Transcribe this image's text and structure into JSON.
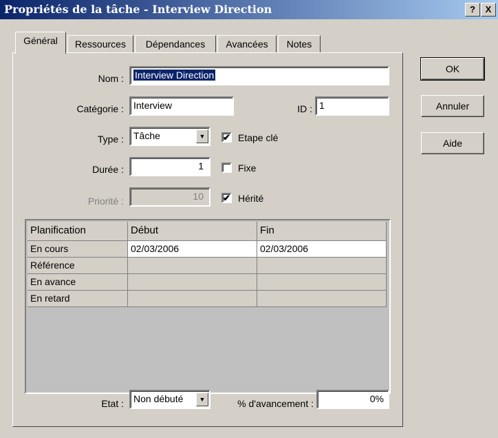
{
  "window": {
    "title": "Propriétés de la tâche - Interview Direction",
    "help_btn": "?",
    "close_btn": "X"
  },
  "tabs": [
    "Général",
    "Ressources",
    "Dépendances",
    "Avancées",
    "Notes"
  ],
  "form": {
    "nom_label": "Nom :",
    "nom_value": "Interview Direction",
    "categorie_label": "Catégorie :",
    "categorie_value": "Interview",
    "id_label": "ID :",
    "id_value": "1",
    "type_label": "Type :",
    "type_value": "Tâche",
    "etape_label": "Etape clé",
    "etape_checked": true,
    "duree_label": "Durée :",
    "duree_value": "1",
    "fixe_label": "Fixe",
    "fixe_checked": false,
    "priorite_label": "Priorité :",
    "priorite_value": "10",
    "herite_label": "Hérité",
    "herite_checked": true
  },
  "grid": {
    "headers": [
      "Planification",
      "Début",
      "Fin"
    ],
    "rows": [
      [
        "En cours",
        "02/03/2006",
        "02/03/2006"
      ],
      [
        "Référence",
        "",
        ""
      ],
      [
        "En avance",
        "",
        ""
      ],
      [
        "En retard",
        "",
        ""
      ]
    ]
  },
  "status": {
    "etat_label": "Etat :",
    "etat_value": "Non débuté",
    "avancement_label": "% d'avancement :",
    "avancement_value": "0%"
  },
  "buttons": {
    "ok": "OK",
    "cancel": "Annuler",
    "help": "Aide"
  },
  "icons": {
    "checked": "✔",
    "dropdown": "▼"
  }
}
